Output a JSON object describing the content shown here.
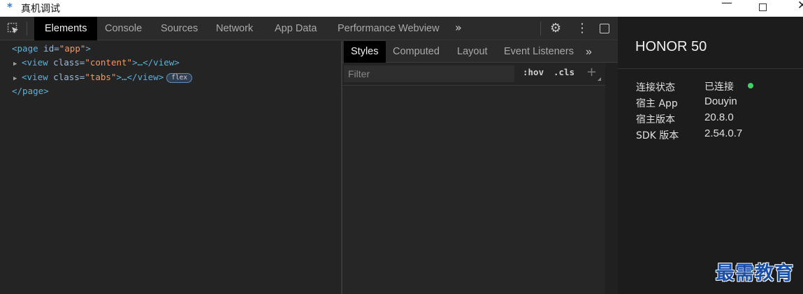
{
  "window": {
    "title": "真机调试",
    "app_icon": "*",
    "minimize": "—",
    "close": "✕"
  },
  "toolbar": {
    "tabs": [
      {
        "label": "Elements",
        "active": true
      },
      {
        "label": "Console"
      },
      {
        "label": "Sources"
      },
      {
        "label": "Network"
      },
      {
        "label": "App Data"
      },
      {
        "label": "Performance Webview"
      }
    ],
    "more": "»",
    "settings_icon": "⚙",
    "menu_icon": "⋮"
  },
  "dom_tree": {
    "lines": [
      {
        "open": "<page",
        "attr": " id=",
        "val": "\"app\"",
        "close": ">"
      },
      {
        "open": "<view",
        "attr": " class=",
        "val": "\"content\"",
        "close": ">…</view>"
      },
      {
        "open": "<view",
        "attr": " class=",
        "val": "\"tabs\"",
        "close": ">…</view>",
        "badge": "flex"
      },
      {
        "end": "</page>"
      }
    ],
    "expand_marker": "▶"
  },
  "styles_panel": {
    "tabs": [
      {
        "label": "Styles",
        "active": true
      },
      {
        "label": "Computed"
      },
      {
        "label": "Layout"
      },
      {
        "label": "Event Listeners"
      }
    ],
    "more": "»",
    "filter_placeholder": "Filter",
    "hov": ":hov",
    "cls": ".cls",
    "plus": "+"
  },
  "device": {
    "name": "HONOR 50",
    "info": [
      {
        "label": "连接状态",
        "value": "已连接"
      },
      {
        "label": "宿主 App",
        "value": "Douyin"
      },
      {
        "label": "宿主版本",
        "value": "20.8.0"
      },
      {
        "label": "SDK 版本",
        "value": "2.54.0.7"
      }
    ],
    "status_color": "#3fd16a"
  },
  "watermark": "最需教育"
}
